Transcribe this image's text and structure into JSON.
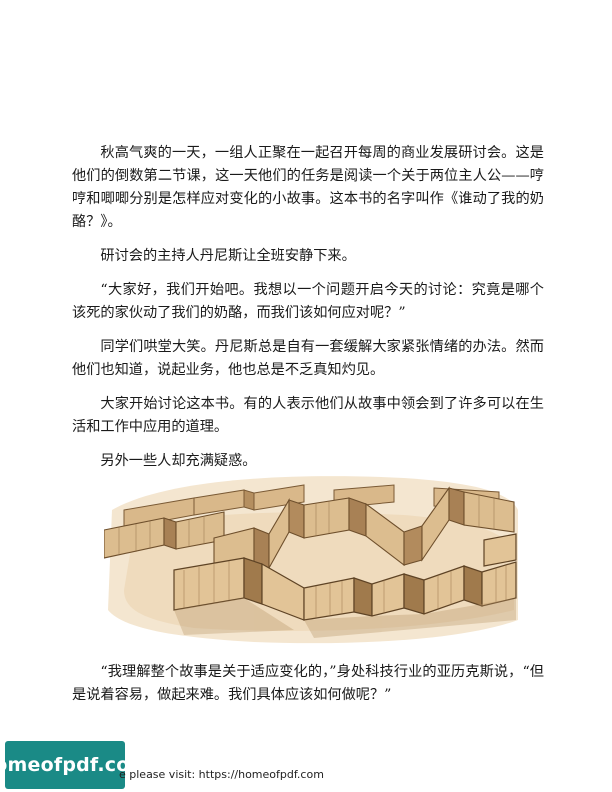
{
  "paragraphs": [
    "秋高气爽的一天，一组人正聚在一起召开每周的商业发展研讨会。这是他们的倒数第二节课，这一天他们的任务是阅读一个关于两位主人公——哼哼和唧唧分别是怎样应对变化的小故事。这本书的名字叫作《谁动了我的奶酪？》。",
    "研讨会的主持人丹尼斯让全班安静下来。",
    "“大家好，我们开始吧。我想以一个问题开启今天的讨论：究竟是哪个该死的家伙动了我们的奶酪，而我们该如何应对呢？”",
    "同学们哄堂大笑。丹尼斯总是自有一套缓解大家紧张情绪的办法。然而他们也知道，说起业务，他也总是不乏真知灼见。",
    "大家开始讨论这本书。有的人表示他们从故事中领会到了许多可以在生活和工作中应用的道理。",
    "另外一些人却充满疑惑。"
  ],
  "after_image": "“我理解整个故事是关于适应变化的，”身处科技行业的亚历克斯说，“但是说着容易，做起来难。我们具体应该如何做呢？”",
  "watermark": {
    "badge_text": "homeofpdf.com",
    "footer_text": "e please visit: https://homeofpdf.com"
  },
  "colors": {
    "maze_wall": "#d9b88a",
    "maze_wall_dark": "#a07a4c",
    "maze_floor": "#f0ddc0",
    "badge": "#1a8a86"
  }
}
